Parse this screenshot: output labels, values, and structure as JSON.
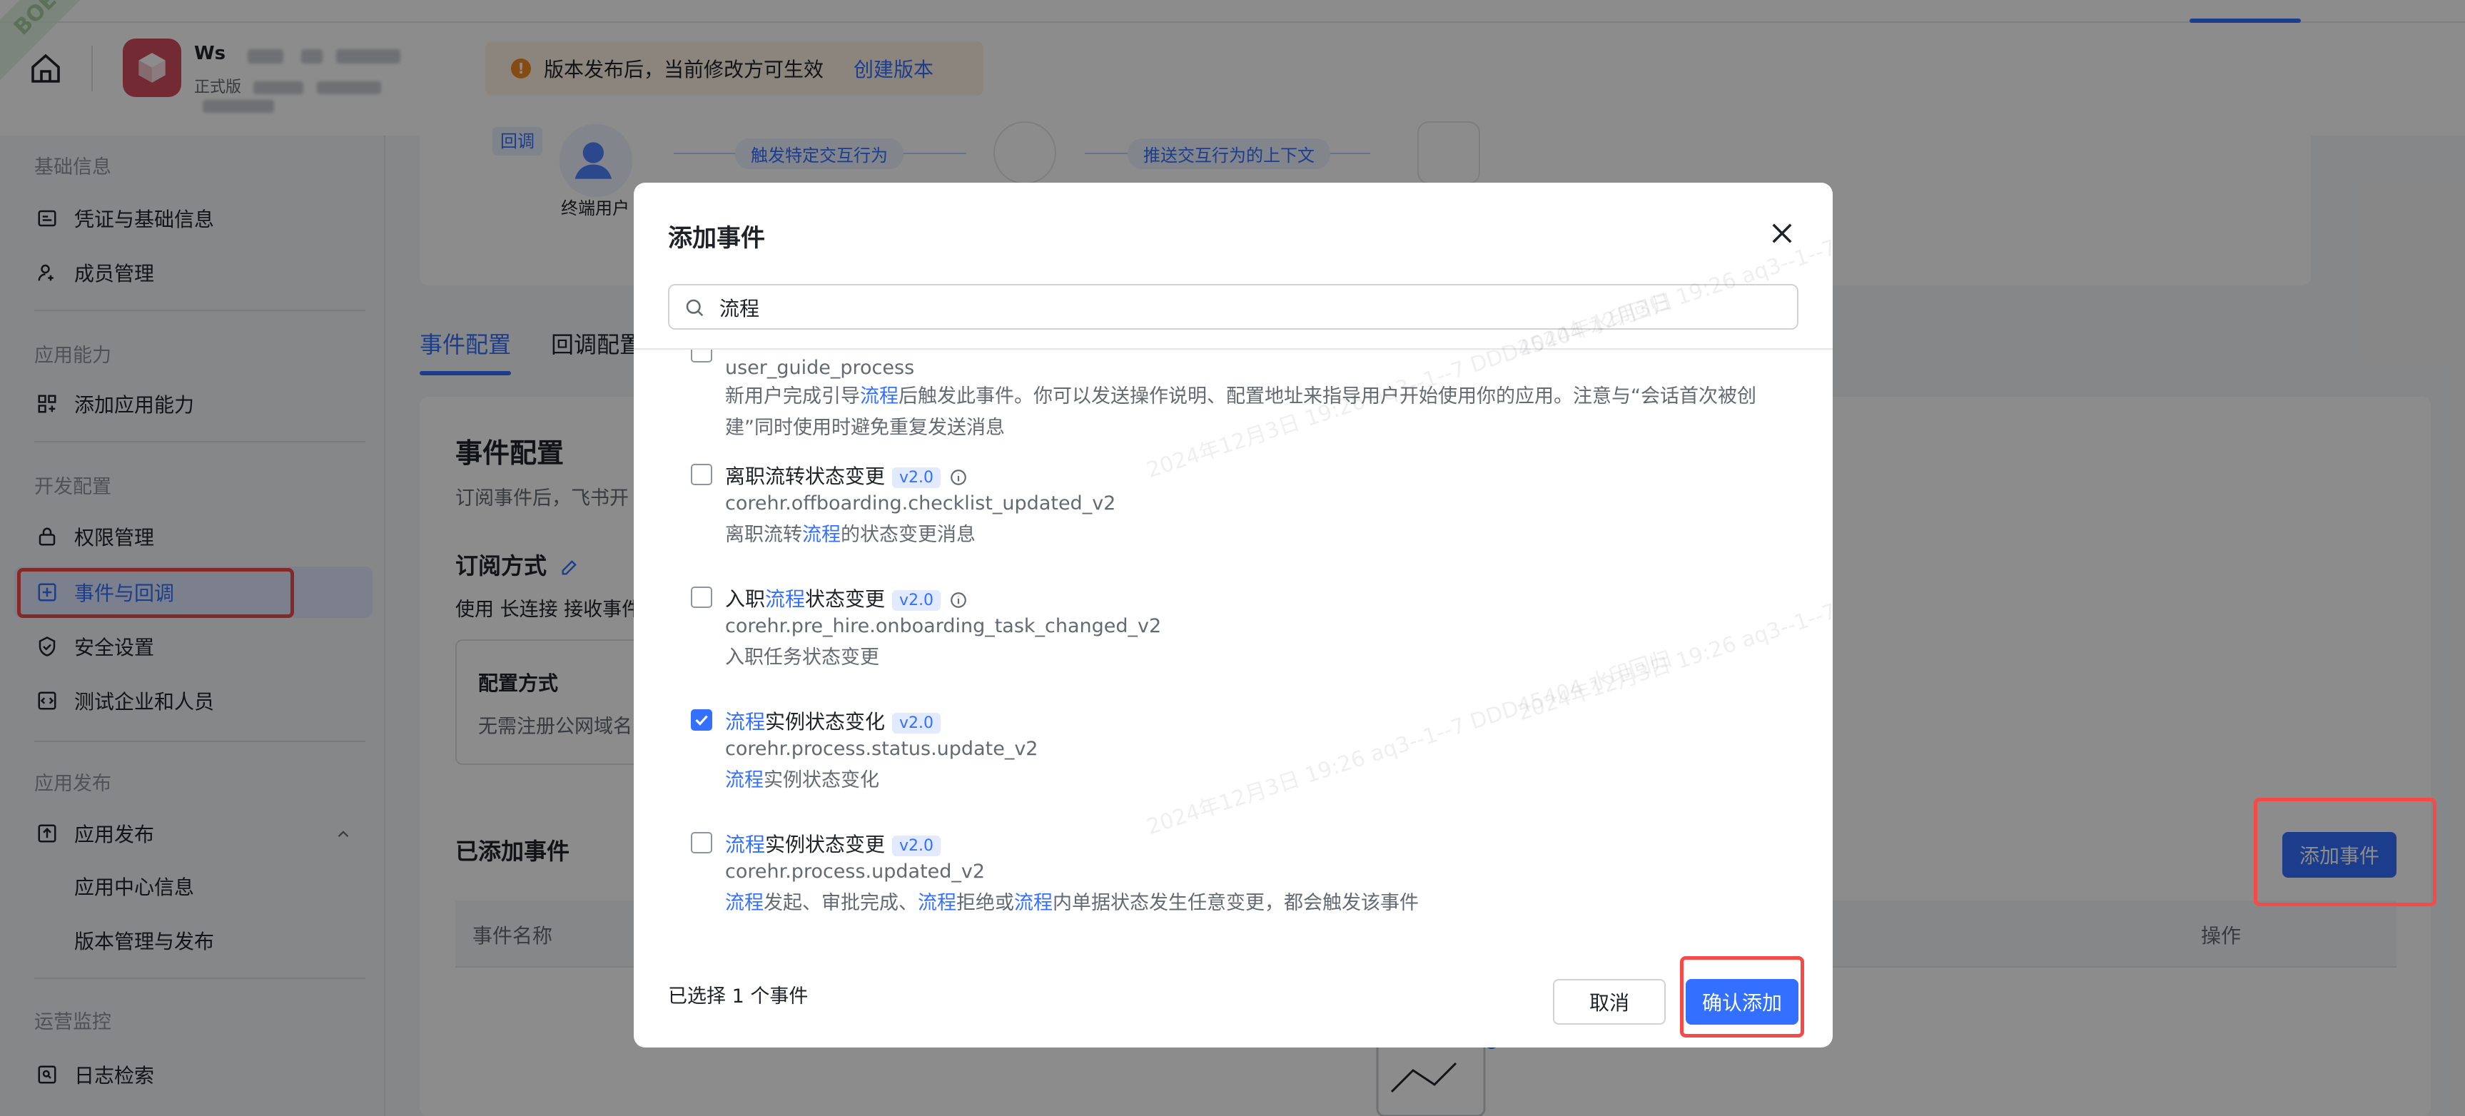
{
  "app": {
    "name_visible": "Ws",
    "subtitle_visible": "正式版",
    "notice_text": "版本发布后，当前修改方可生效",
    "notice_link": "创建版本",
    "ribbon_text": "BOE"
  },
  "sidebar": {
    "groups": {
      "basic": "基础信息",
      "capability": "应用能力",
      "dev": "开发配置",
      "publish": "应用发布",
      "ops": "运营监控"
    },
    "items": {
      "credentials": "凭证与基础信息",
      "members": "成员管理",
      "add_capability": "添加应用能力",
      "permissions": "权限管理",
      "events": "事件与回调",
      "security": "安全设置",
      "test_company": "测试企业和人员",
      "publish": "应用发布",
      "app_center": "应用中心信息",
      "versions": "版本管理与发布",
      "logs": "日志检索"
    }
  },
  "main": {
    "flow": {
      "tag": "回调",
      "user_label": "终端用户",
      "step1": "触发特定交互行为",
      "step2": "推送交互行为的上下文"
    },
    "tabs": [
      "事件配置",
      "回调配置"
    ],
    "title": "事件配置",
    "subtitle": "订阅事件后，飞书开",
    "subscribe_mode": "订阅方式",
    "subscribe_desc": "使用 长连接 接收事件",
    "config_title": "配置方式",
    "config_desc": "无需注册公网域名",
    "added_events_title": "已添加事件",
    "table_headers": {
      "name": "事件名称",
      "op": "操作"
    },
    "add_event_button": "添加事件"
  },
  "modal": {
    "title": "添加事件",
    "search_value": "流程",
    "events": [
      {
        "key": "user_guide_process",
        "desc_pre": "新用户完成引导",
        "desc_hl": "流程",
        "desc_post": "后触发此事件。你可以发送操作说明、配置地址来指导用户开始使用你的应用。注意与“会话首次被创建”同时使用时避免重复发送消息",
        "checked": false
      },
      {
        "name_pre": "离职",
        "name_hl": "流转",
        "name_post": "状态变更",
        "name_full": "离职流转状态变更",
        "version": "v2.0",
        "key": "corehr.offboarding.checklist_updated_v2",
        "desc_pre": "离职流转",
        "desc_hl": "流程",
        "desc_post": "的状态变更消息",
        "checked": false
      },
      {
        "name_pre": "入职",
        "name_hl": "流程",
        "name_post": "状态变更",
        "version": "v2.0",
        "key": "corehr.pre_hire.onboarding_task_changed_v2",
        "desc": "入职任务状态变更",
        "checked": false
      },
      {
        "name_hl": "流程",
        "name_post": "实例状态变化",
        "version": "v2.0",
        "key": "corehr.process.status.update_v2",
        "desc_hl": "流程",
        "desc_post": "实例状态变化",
        "checked": true
      },
      {
        "name_hl": "流程",
        "name_post": "实例状态变更",
        "version": "v2.0",
        "key": "corehr.process.updated_v2",
        "desc_parts": [
          "流程",
          "发起、审批完成、",
          "流程",
          "拒绝或",
          "流程",
          "内单据状态发生任意变更，都会触发该事件"
        ],
        "checked": false
      }
    ],
    "selected_count": "已选择 1 个事件",
    "cancel": "取消",
    "confirm": "确认添加"
  },
  "watermark": "2024年12月3日 19:26 aq3--1--7  DDD45404 水印回归",
  "colors": {
    "accent": "#3370ff",
    "danger": "#f54a45",
    "warning": "#f08a24"
  }
}
